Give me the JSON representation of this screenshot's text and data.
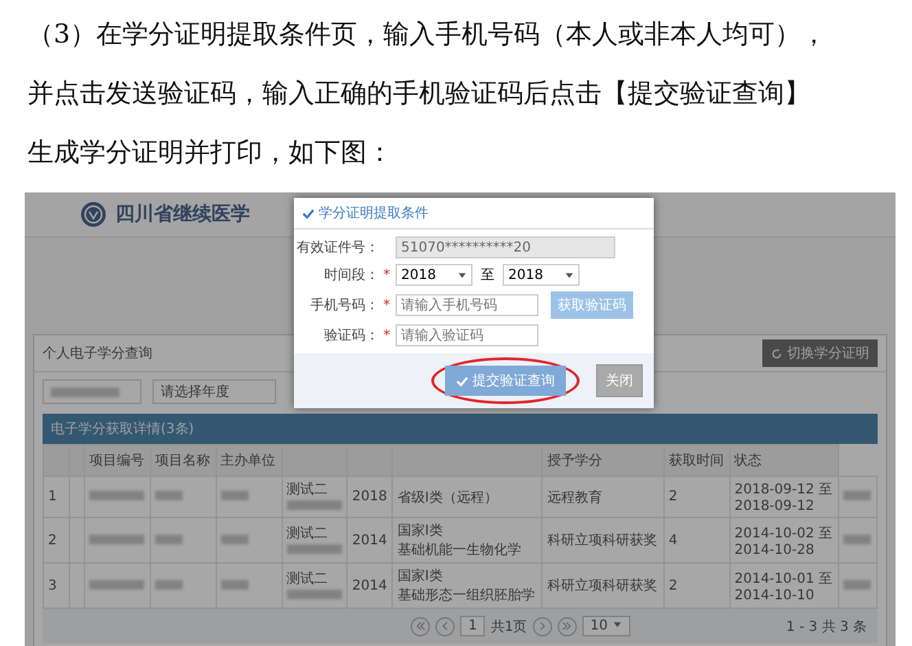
{
  "instructions": [
    "（3）在学分证明提取条件页，输入手机号码（本人或非本人均可），",
    "并点击发送验证码，输入正确的手机验证码后点击【提交验证查询】",
    "生成学分证明并打印，如下图："
  ],
  "screenshot": {
    "site_title": "四川省继续医学",
    "panel_title": "个人电子学分查询",
    "year_select": {
      "placeholder": "请选择年度"
    },
    "switch_button": "切换学分证明",
    "detail_bar": "电子学分获取详情(3条)",
    "columns": [
      "项目编号",
      "项目名称",
      "主办单位",
      "",
      "",
      "",
      "授予学分",
      "获取时间",
      "状态"
    ],
    "rows": [
      {
        "index": "1",
        "org": "测试二",
        "year": "2018",
        "category": [
          "省级I类（远程）"
        ],
        "type": "远程教育",
        "credits": "2",
        "time": [
          "2018-09-12 至",
          "2018-09-12"
        ]
      },
      {
        "index": "2",
        "org": "测试二",
        "year": "2014",
        "category": [
          "国家I类",
          "基础机能一生物化学"
        ],
        "type": "科研立项科研获奖",
        "credits": "4",
        "time": [
          "2014-10-02 至",
          "2014-10-28"
        ]
      },
      {
        "index": "3",
        "org": "测试二",
        "year": "2014",
        "category": [
          "国家I类",
          "基础形态一组织胚胎学"
        ],
        "type": "科研立项科研获奖",
        "credits": "2",
        "time": [
          "2014-10-01 至",
          "2014-10-10"
        ]
      }
    ],
    "pagination": {
      "page": "1",
      "pages": "共1页",
      "per_page": "10",
      "summary": "1 - 3 共 3 条"
    },
    "dialog": {
      "title": "学分证明提取条件",
      "fields": [
        {
          "kind": "readonly",
          "label": "有效证件号：",
          "value": "51070**********20"
        },
        {
          "kind": "range",
          "label": "时间段：",
          "mark": "*",
          "from": "2018",
          "sep": "至",
          "to": "2018"
        },
        {
          "kind": "input_button",
          "label": "手机号码：",
          "mark": "*",
          "placeholder": "请输入手机号码",
          "button": "获取验证码"
        },
        {
          "kind": "input",
          "label": "验证码：",
          "mark": "*",
          "placeholder": "请输入验证码"
        }
      ],
      "submit": {
        "label": "提交验证查询",
        "circled": true
      },
      "close": "关闭"
    }
  }
}
